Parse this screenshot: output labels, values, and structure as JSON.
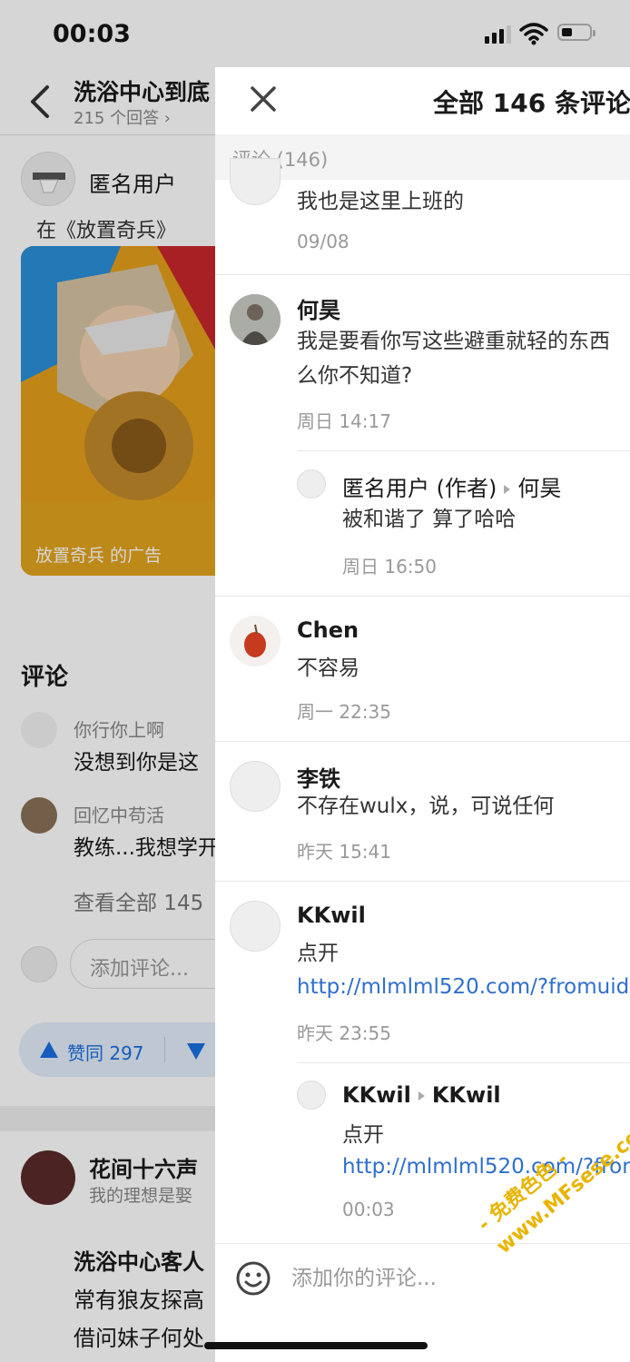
{
  "status_bar": {
    "time": "00:03"
  },
  "background": {
    "nav_title": "洗浴中心到底",
    "nav_subtitle": "215 个回答 ›",
    "author": {
      "name": "匿名用户"
    },
    "ad_top_text": "在《放置奇兵》",
    "ad_label": "放置奇兵 的广告",
    "comments_heading": "评论",
    "preview_comments": [
      {
        "name": "你行你上啊",
        "text": "没想到你是这"
      },
      {
        "name": "回忆中苟活",
        "text": "教练...我想学开"
      }
    ],
    "view_all": "查看全部 145",
    "add_comment_placeholder": "添加评论...",
    "vote": {
      "up_label": "赞同 297"
    },
    "next_answer": {
      "name": "花间十六声",
      "bio": "我的理想是娶",
      "lines": [
        "洗浴中心客人",
        "常有狼友探高",
        "借问妹子何处"
      ]
    }
  },
  "panel": {
    "title": "全部 146 条评论",
    "section_label": "评论 (146)",
    "comments": [
      {
        "text": "我也是这里上班的",
        "time": "09/08"
      },
      {
        "name": "何昊",
        "text_lines": [
          "我是要看你写这些避重就轻的东西",
          "么你不知道?"
        ],
        "time": "周日 14:17",
        "reply": {
          "from": "匿名用户 (作者)",
          "to": "何昊",
          "text": "被和谐了   算了哈哈",
          "time": "周日 16:50"
        }
      },
      {
        "name": "Chen",
        "text": "不容易",
        "time": "周一 22:35"
      },
      {
        "name": "李铁",
        "text": "不存在wulx，说，可说任何",
        "time": "昨天 15:41"
      },
      {
        "name": "KKwil",
        "text": "点开",
        "link": "http://mlmlml520.com/?fromuid=",
        "time": "昨天 23:55",
        "reply": {
          "from": "KKwil",
          "to": "KKwil",
          "text": "点开",
          "link": "http://mlmlml520.com/?from",
          "time": "00:03"
        }
      }
    ],
    "input_placeholder": "添加你的评论..."
  },
  "watermark": {
    "line1": "- 免费色色 -",
    "line2": "www.MFsese.com"
  }
}
